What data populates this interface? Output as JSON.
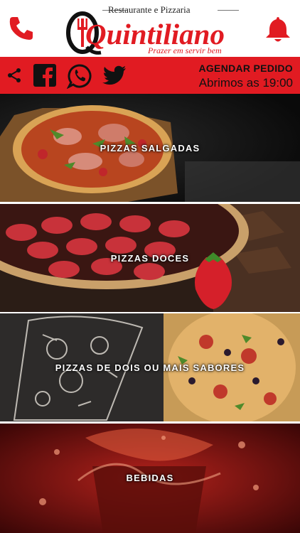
{
  "header": {
    "tagline_top": "Restaurante e Pizzaria",
    "brand": "Quintiliano",
    "slogan": "Prazer em servir bem",
    "phone_icon": "phone-icon",
    "bell_icon": "bell-icon"
  },
  "bar": {
    "share_icon": "share-icon",
    "social": [
      "facebook-icon",
      "whatsapp-icon",
      "twitter-icon"
    ],
    "schedule_label": "AGENDAR PEDIDO",
    "opening_text": "Abrimos as 19:00"
  },
  "categories": [
    {
      "label": "PIZZAS SALGADAS"
    },
    {
      "label": "PIZZAS DOCES"
    },
    {
      "label": "PIZZAS DE DOIS OU MAIS SABORES"
    },
    {
      "label": "BEBIDAS"
    }
  ],
  "colors": {
    "brand_red": "#e11b22",
    "dark": "#1c1c1c"
  }
}
